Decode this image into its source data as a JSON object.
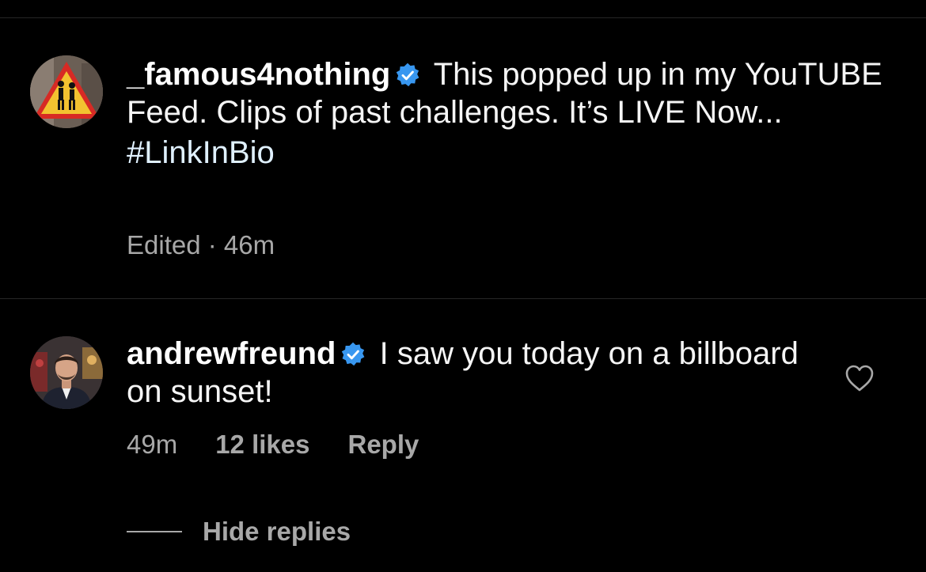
{
  "colors": {
    "background": "#000000",
    "text": "#ffffff",
    "muted": "#a8a8a8",
    "verified_badge": "#3897f0",
    "hashtag": "#e0f1ff",
    "divider": "#262626"
  },
  "caption": {
    "avatar_icon": "pedestrian-warning-sign-avatar",
    "username": "_famous4nothing",
    "verified_icon": "verified-badge-icon",
    "text": "This popped up in my YouTUBE Feed.  Clips of past challenges. It’s LIVE Now...",
    "hashtag": "#LinkInBio",
    "meta": "Edited · 46m"
  },
  "reply": {
    "avatar_icon": "man-in-suit-avatar",
    "username": "andrewfreund",
    "verified_icon": "verified-badge-icon",
    "text": "I saw you today on a billboard on sunset!",
    "time": "49m",
    "likes": "12 likes",
    "reply_label": "Reply",
    "like_icon": "heart-outline-icon"
  },
  "hide_replies": {
    "label": "Hide replies"
  }
}
